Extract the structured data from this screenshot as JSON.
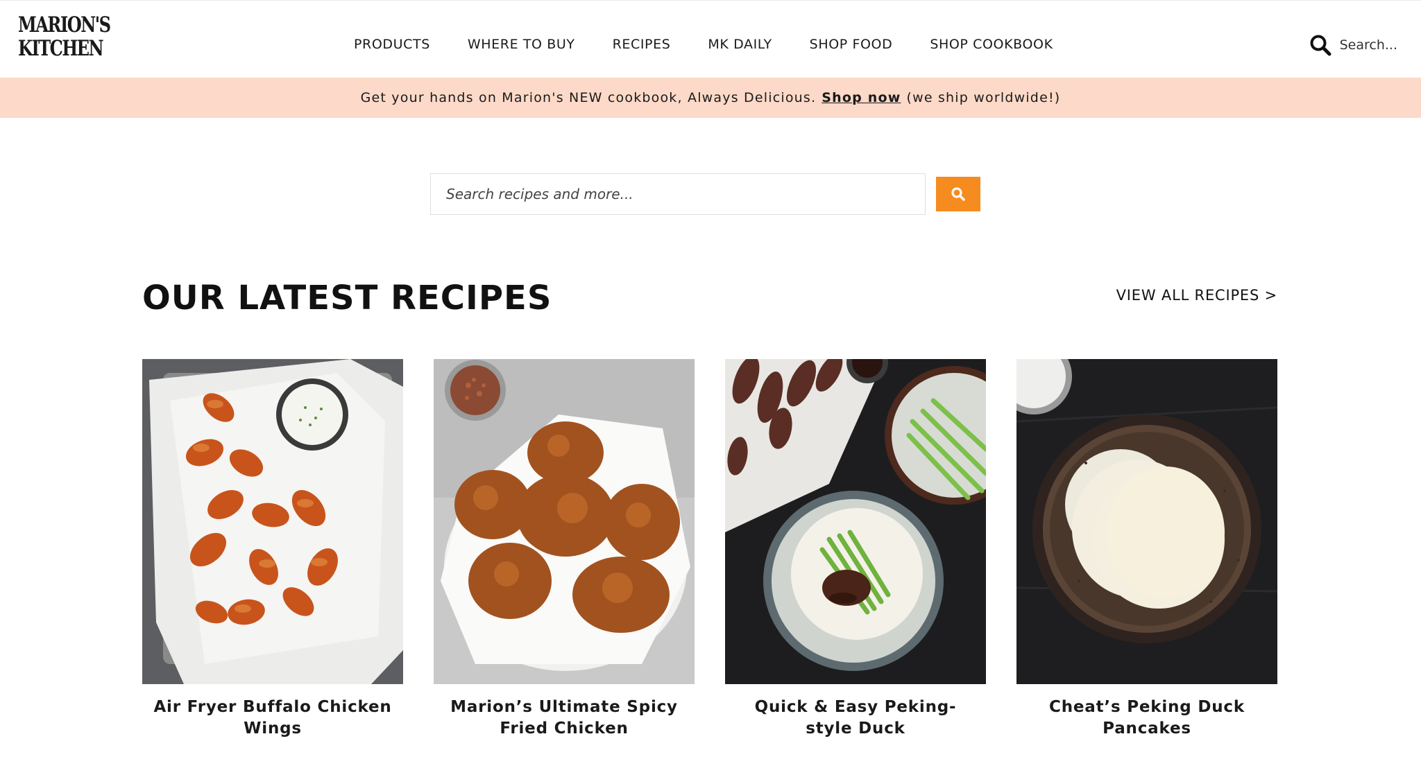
{
  "brand": {
    "logo_line1": "MARION'S",
    "logo_line2": "KITCHEN"
  },
  "nav": {
    "items": [
      {
        "label": "PRODUCTS"
      },
      {
        "label": "WHERE TO BUY"
      },
      {
        "label": "RECIPES"
      },
      {
        "label": "MK DAILY"
      },
      {
        "label": "SHOP FOOD"
      },
      {
        "label": "SHOP COOKBOOK"
      }
    ]
  },
  "header_search": {
    "label": "Search...",
    "icon": "search-icon"
  },
  "promo": {
    "text_before": "Get your hands on Marion's NEW cookbook, Always Delicious.",
    "link": "Shop now",
    "text_after": "(we ship worldwide!)"
  },
  "search": {
    "placeholder": "Search recipes and more...",
    "button_icon": "search-icon"
  },
  "latest": {
    "heading": "OUR LATEST RECIPES",
    "view_all": "VIEW ALL RECIPES >",
    "recipes": [
      {
        "title": "Air Fryer Buffalo Chicken Wings",
        "image": "buffalo-wings-photo"
      },
      {
        "title": "Marion’s Ultimate Spicy Fried Chicken",
        "image": "fried-chicken-photo"
      },
      {
        "title": "Quick & Easy Peking-style Duck",
        "image": "peking-duck-photo"
      },
      {
        "title": "Cheat’s Peking Duck Pancakes",
        "image": "duck-pancakes-photo"
      }
    ]
  },
  "colors": {
    "accent": "#f68b1f",
    "promo_bg": "#fcd9c8",
    "text": "#1a1a1a"
  }
}
